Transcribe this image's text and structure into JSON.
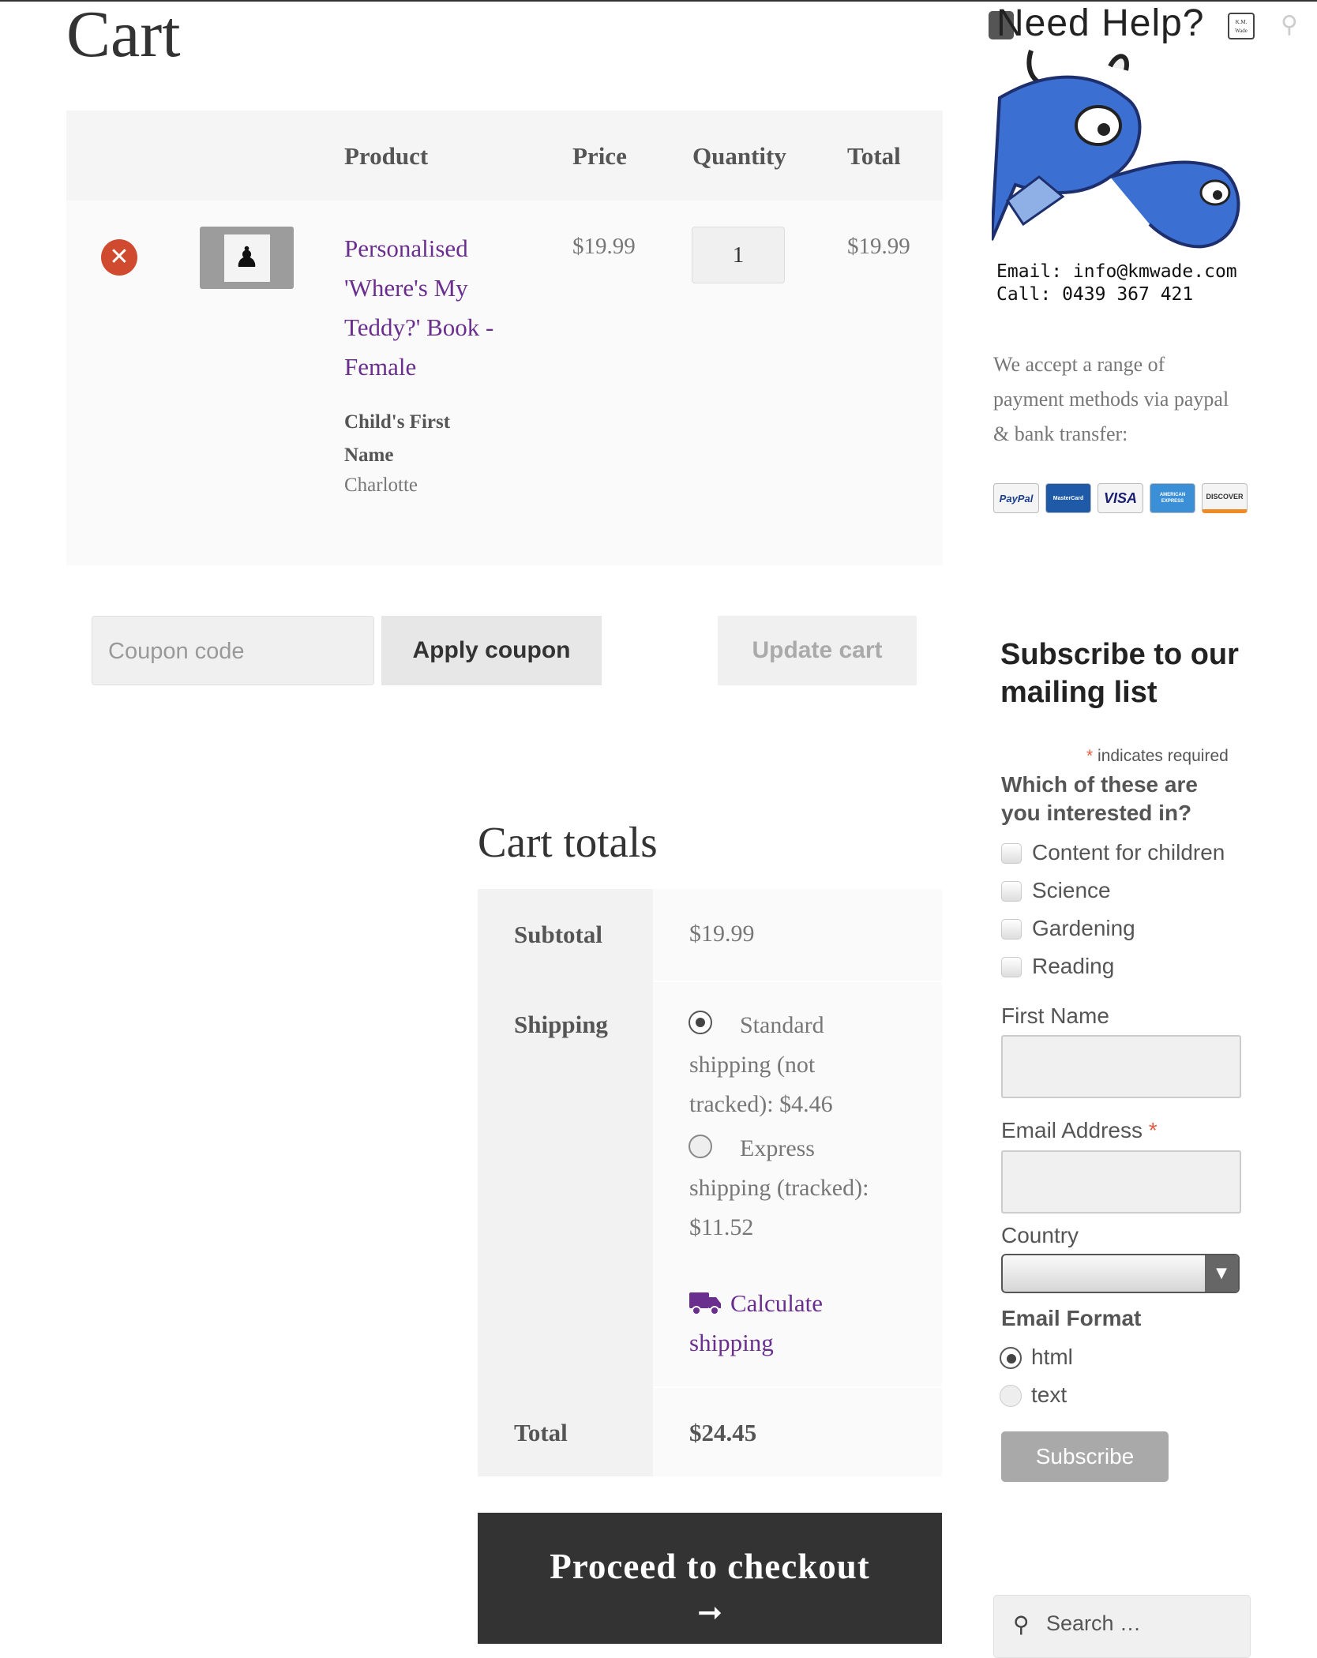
{
  "page": {
    "title": "Cart"
  },
  "table": {
    "headers": {
      "product": "Product",
      "price": "Price",
      "quantity": "Quantity",
      "total": "Total"
    },
    "row": {
      "product_lines": [
        "Personalised",
        "'Where's My",
        "Teddy?' Book -",
        "Female"
      ],
      "meta_label_lines": [
        "Child's First",
        "Name"
      ],
      "meta_value": "Charlotte",
      "price": "$19.99",
      "quantity": "1",
      "total": "$19.99"
    }
  },
  "actions": {
    "coupon_placeholder": "Coupon code",
    "apply_coupon": "Apply coupon",
    "update_cart": "Update cart"
  },
  "totals": {
    "heading": "Cart totals",
    "subtotal_label": "Subtotal",
    "subtotal_value": "$19.99",
    "shipping_label": "Shipping",
    "standard_lines": [
      "Standard",
      "shipping (not",
      "tracked): $4.46"
    ],
    "express_lines": [
      "Express",
      "shipping (tracked):",
      "$11.52"
    ],
    "calculate_lines": [
      "Calculate",
      "shipping"
    ],
    "total_label": "Total",
    "total_value": "$24.45",
    "checkout": "Proceed to checkout",
    "checkout_arrow": "➞"
  },
  "sidebar": {
    "banner": {
      "heading": "Need Help?",
      "email": "Email: info@kmwade.com",
      "call": "Call: 0439 367 421",
      "badge": "K.M. Wade"
    },
    "payment_lines": [
      "We accept a range of",
      "payment methods via paypal",
      "& bank transfer:"
    ],
    "cards": [
      "PayPal",
      "MasterCard",
      "VISA",
      "AMERICAN EXPRESS",
      "DISCOVER"
    ],
    "subscribe": {
      "heading_lines": [
        "Subscribe to our",
        "mailing list"
      ],
      "required_asterisk": "*",
      "required_note": "indicates required",
      "interest_lines": [
        "Which of these are",
        "you interested in?"
      ],
      "interests": [
        "Content for children",
        "Science",
        "Gardening",
        "Reading"
      ],
      "first_name": "First Name",
      "email_label": "Email Address",
      "email_asterisk": "*",
      "country": "Country",
      "email_format": "Email Format",
      "format_options": [
        "html",
        "text"
      ],
      "button": "Subscribe"
    },
    "search_placeholder": "Search …"
  },
  "colors": {
    "link": "#6a2e8e",
    "remove": "#d04a2f",
    "checkout_bg": "#333333",
    "asterisk": "#e85c41"
  }
}
